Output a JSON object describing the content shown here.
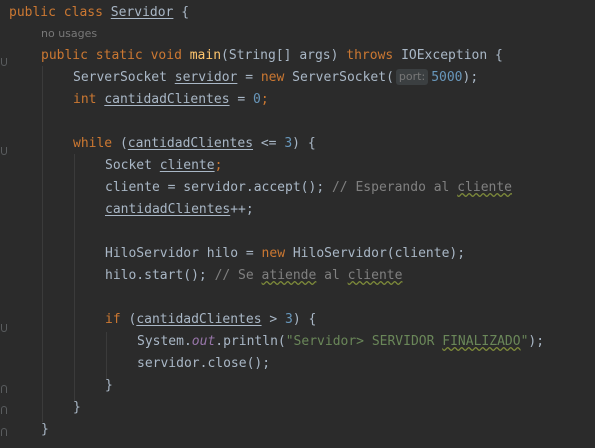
{
  "code": {
    "l1": {
      "kw1": "public",
      "kw2": "class",
      "name": "Servidor",
      "brace": " {"
    },
    "inlay_usages": "no usages",
    "l2": {
      "kw1": "public",
      "kw2": "static",
      "kw3": "void",
      "fn": "main",
      "params": "(String[] args) ",
      "kw4": "throws",
      "exc": " IOException {"
    },
    "l3": {
      "type": "ServerSocket ",
      "var": "servidor",
      "op": " = ",
      "kw": "new",
      "cls": " ServerSocket(",
      "hint": "port:",
      "num": "5000",
      "end": ");"
    },
    "l4": {
      "kw": "int",
      "var": "cantidadClientes",
      "op": " = ",
      "num": "0",
      "end": ";"
    },
    "l5": {
      "kw": "while",
      "open": " (",
      "var": "cantidadClientes",
      "op": " <= ",
      "num": "3",
      "end": ") {"
    },
    "l6": {
      "type": "Socket ",
      "var": "cliente",
      "end": ";"
    },
    "l7": {
      "a": "cliente = servidor.accept(); ",
      "cmt1": "// Esperando al ",
      "cmt2": "cliente"
    },
    "l8": {
      "var": "cantidadClientes",
      "end": "++;"
    },
    "l9": {
      "a": "HiloServidor hilo = ",
      "kw": "new",
      "b": " HiloServidor(cliente);"
    },
    "l10": {
      "a": "hilo.start(); ",
      "cmt1": "// Se ",
      "cmt2": "atiende",
      "cmt3": " al ",
      "cmt4": "cliente"
    },
    "l11": {
      "kw": "if",
      "open": " (",
      "var": "cantidadClientes",
      "op": " > ",
      "num": "3",
      "end": ") {"
    },
    "l12": {
      "a": "System.",
      "fld": "out",
      "b": ".println(",
      "s1": "\"Servidor> SERVIDOR ",
      "s2": "FINALIZADO",
      "s3": "\"",
      "end": ");"
    },
    "l13": {
      "a": "servidor.close();"
    },
    "l14": {
      "a": "}"
    },
    "l15": {
      "a": "}"
    },
    "l16": {
      "a": "}"
    }
  },
  "colors": {
    "background": "#2b2b2b",
    "keyword": "#cc7832",
    "text": "#a9b7c6",
    "function": "#ffc66d",
    "number": "#6897bb",
    "string": "#6a8759",
    "comment": "#808080"
  }
}
